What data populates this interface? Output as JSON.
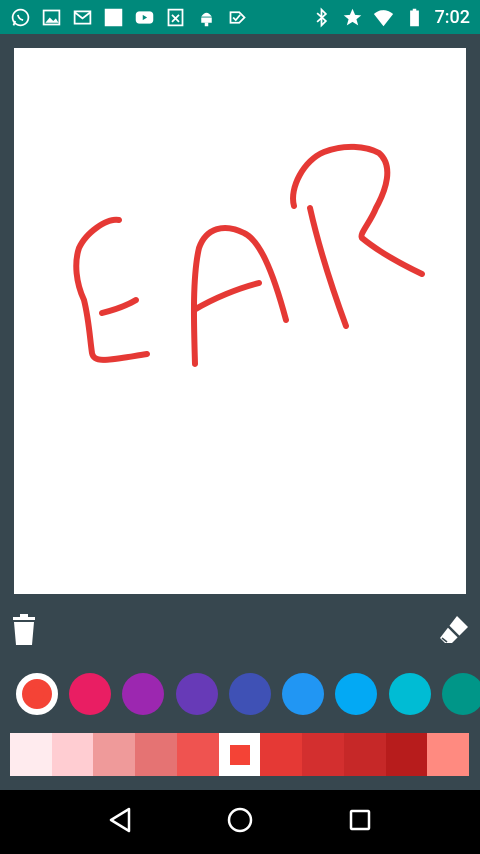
{
  "status_bar": {
    "time": "7:02",
    "left_icons": [
      "whatsapp-icon",
      "gallery-icon",
      "gmail-icon",
      "blank-notification-icon",
      "youtube-icon",
      "file-icon",
      "android-icon",
      "check-tag-icon"
    ],
    "right_icons": [
      "bluetooth-icon",
      "star-icon",
      "wifi-icon",
      "battery-icon"
    ],
    "background": "#00897b"
  },
  "canvas": {
    "background": "#ffffff",
    "drawing_color": "#e53935",
    "drawn_text": "EAR"
  },
  "toolbar": {
    "trash": "trash-icon",
    "eraser": "eraser-icon"
  },
  "colors": {
    "swatches": [
      "#f44336",
      "#e91e63",
      "#9c27b0",
      "#673ab7",
      "#3f51b5",
      "#2196f3",
      "#03a9f4",
      "#00bcd4",
      "#009688"
    ],
    "selected_index": 0
  },
  "shades": {
    "values": [
      "#ffebee",
      "#ffcdd2",
      "#ef9a9a",
      "#e57373",
      "#ef5350",
      "#f44336",
      "#e53935",
      "#d32f2f",
      "#c62828",
      "#b71c1c",
      "#ff8a80"
    ],
    "selected_index": 5
  },
  "nav_bar": {
    "buttons": [
      "back-icon",
      "home-icon",
      "recents-icon"
    ]
  }
}
